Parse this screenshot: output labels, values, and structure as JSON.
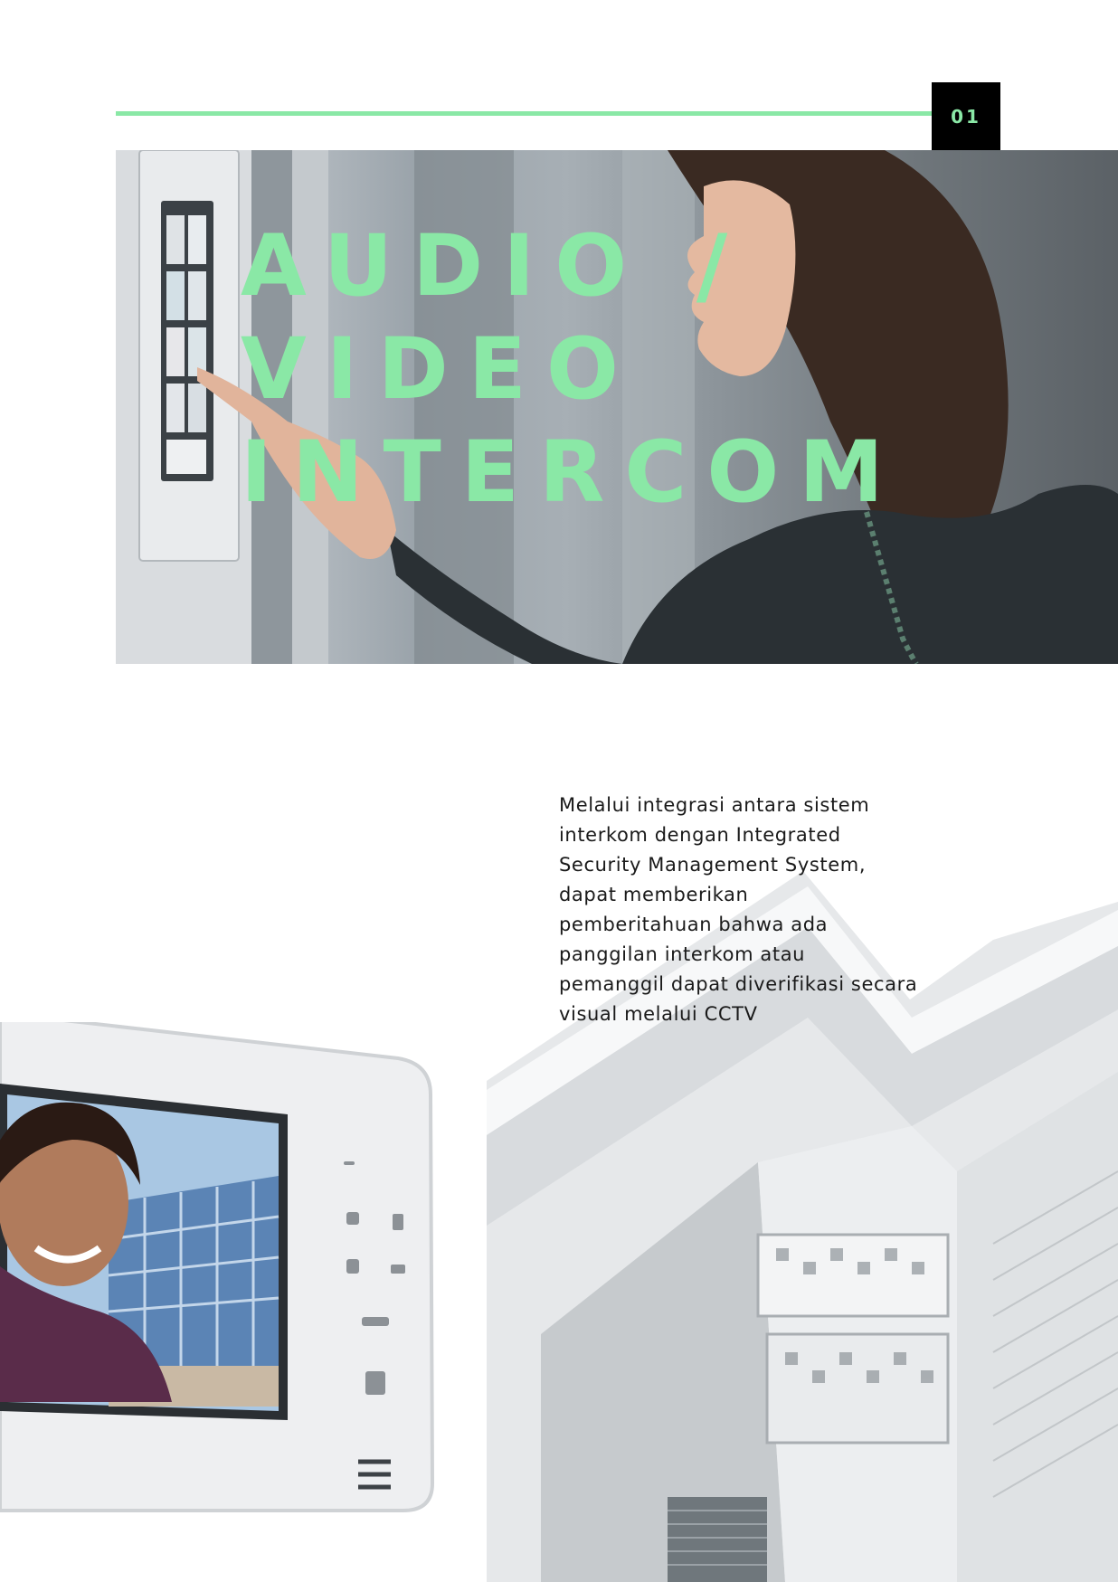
{
  "header": {
    "page_number": "01"
  },
  "hero": {
    "title_lines": [
      "AUDIO /",
      "VIDEO",
      "INTERCOM"
    ]
  },
  "body": {
    "paragraph_lines": [
      "Melalui integrasi antara sistem",
      "interkom dengan Integrated",
      "Security Management System,",
      "dapat memberikan",
      "pemberitahuan bahwa ada",
      "panggilan interkom atau",
      "pemanggil dapat diverifikasi secara",
      "visual melalui CCTV"
    ]
  },
  "colors": {
    "accent": "#8ae8a6",
    "page_number_bg": "#000000",
    "text": "#1a1a1a",
    "background": "#ffffff"
  }
}
